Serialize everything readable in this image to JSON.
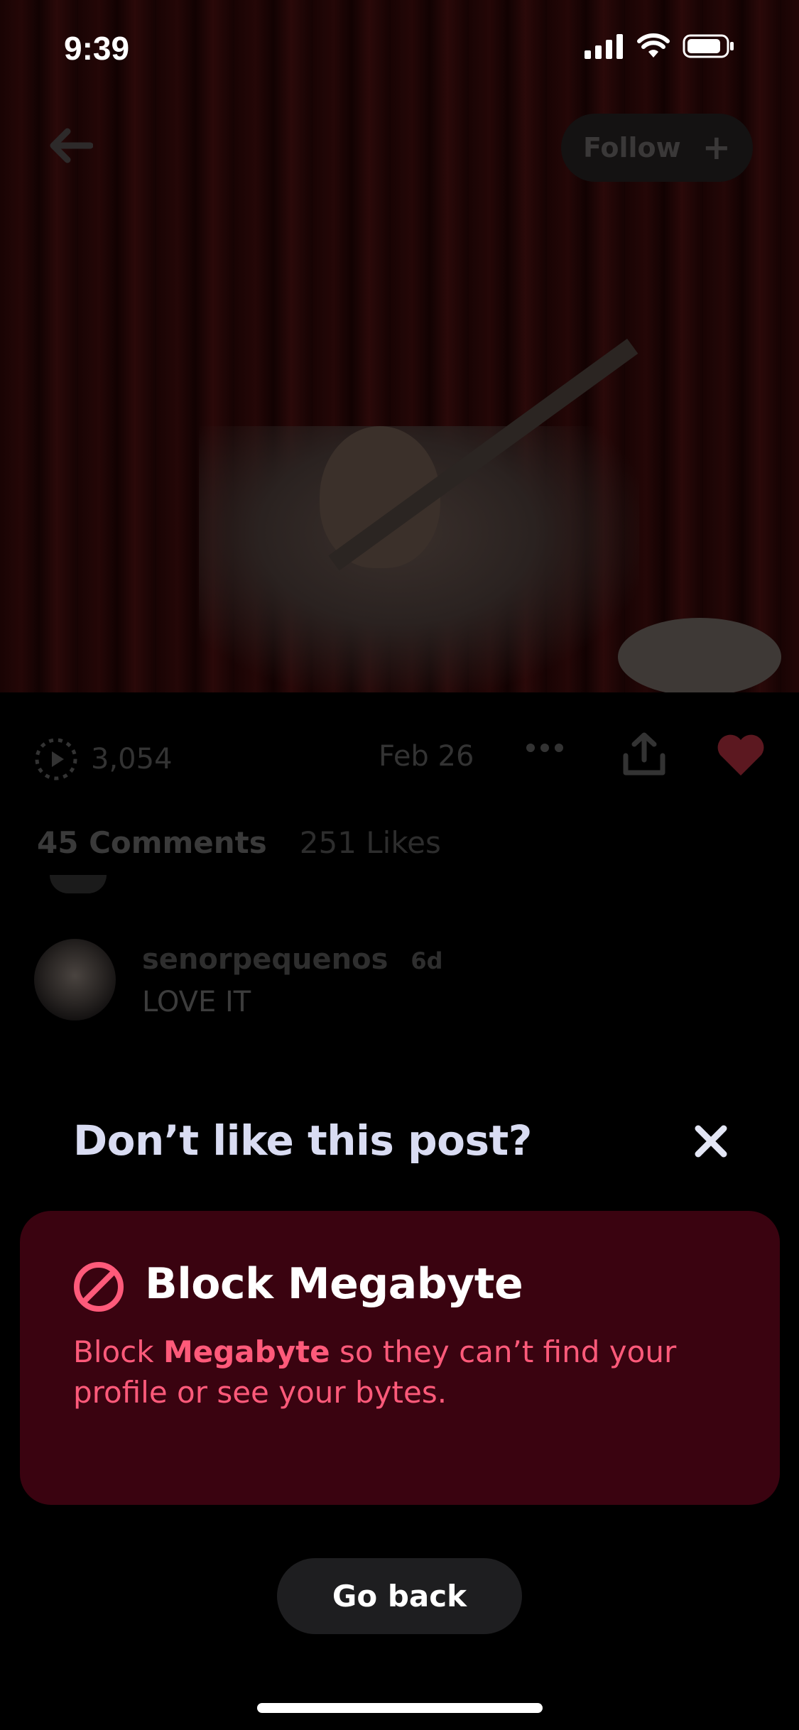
{
  "status_bar": {
    "time": "9:39"
  },
  "header": {
    "follow_label": "Follow"
  },
  "post_meta": {
    "views": "3,054",
    "date": "Feb 26"
  },
  "tabs": {
    "comments": "45 Comments",
    "likes": "251 Likes"
  },
  "comment": {
    "author": "senorpequenos",
    "time": "6d",
    "text": "LOVE IT"
  },
  "sheet": {
    "title": "Don’t like this post?",
    "block_title": "Block Megabyte",
    "block_desc_prefix": "Block ",
    "block_desc_name": "Megabyte",
    "block_desc_suffix": " so they can’t find your profile or see your bytes.",
    "go_back_label": "Go back"
  },
  "colors": {
    "card_background": "#3a0310",
    "accent_pink": "#ff5a7a",
    "title_color": "#d9dcf2",
    "heart_red": "#5c1820"
  },
  "icons": [
    "back-arrow-icon",
    "plus-icon",
    "views-icon",
    "more-icon",
    "share-icon",
    "heart-icon",
    "close-icon",
    "block-icon",
    "signal-icon",
    "wifi-icon",
    "battery-icon"
  ]
}
